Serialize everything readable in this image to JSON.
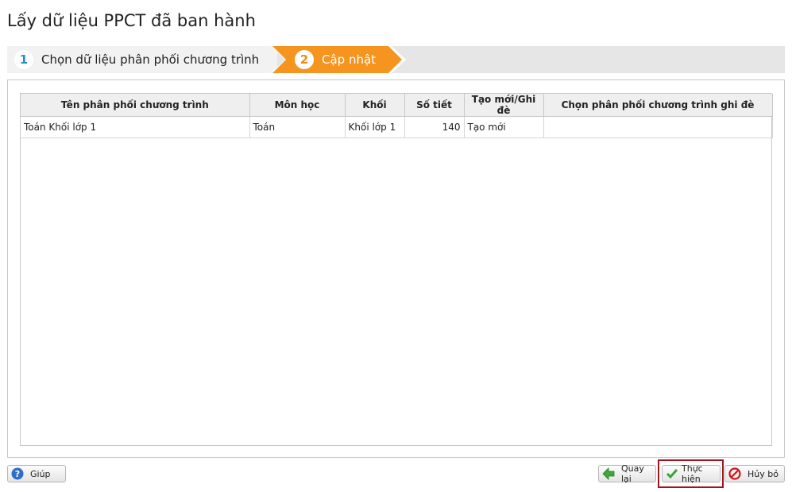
{
  "page": {
    "title": "Lấy dữ liệu PPCT đã ban hành"
  },
  "wizard": {
    "steps": [
      {
        "number": "1",
        "label": "Chọn dữ liệu phân phối chương trình"
      },
      {
        "number": "2",
        "label": "Cập nhật"
      }
    ],
    "active_color": "#F5941E"
  },
  "table": {
    "headers": [
      "Tên phân phối chương trình",
      "Môn học",
      "Khối",
      "Số tiết",
      "Tạo mới/Ghi đè",
      "Chọn phân phối chương trình ghi đè"
    ],
    "rows": [
      {
        "name": "Toán Khối lớp 1",
        "subject": "Toán",
        "grade": "Khối lớp 1",
        "periods": "140",
        "mode": "Tạo mới",
        "overwrite": ""
      }
    ]
  },
  "buttons": {
    "help": "Giúp",
    "back": "Quay lại",
    "execute": "Thực hiện",
    "cancel": "Hủy bỏ"
  },
  "icons": {
    "help": "help-icon",
    "back": "back-arrow-icon",
    "execute": "checkmark-icon",
    "cancel": "cancel-icon"
  }
}
